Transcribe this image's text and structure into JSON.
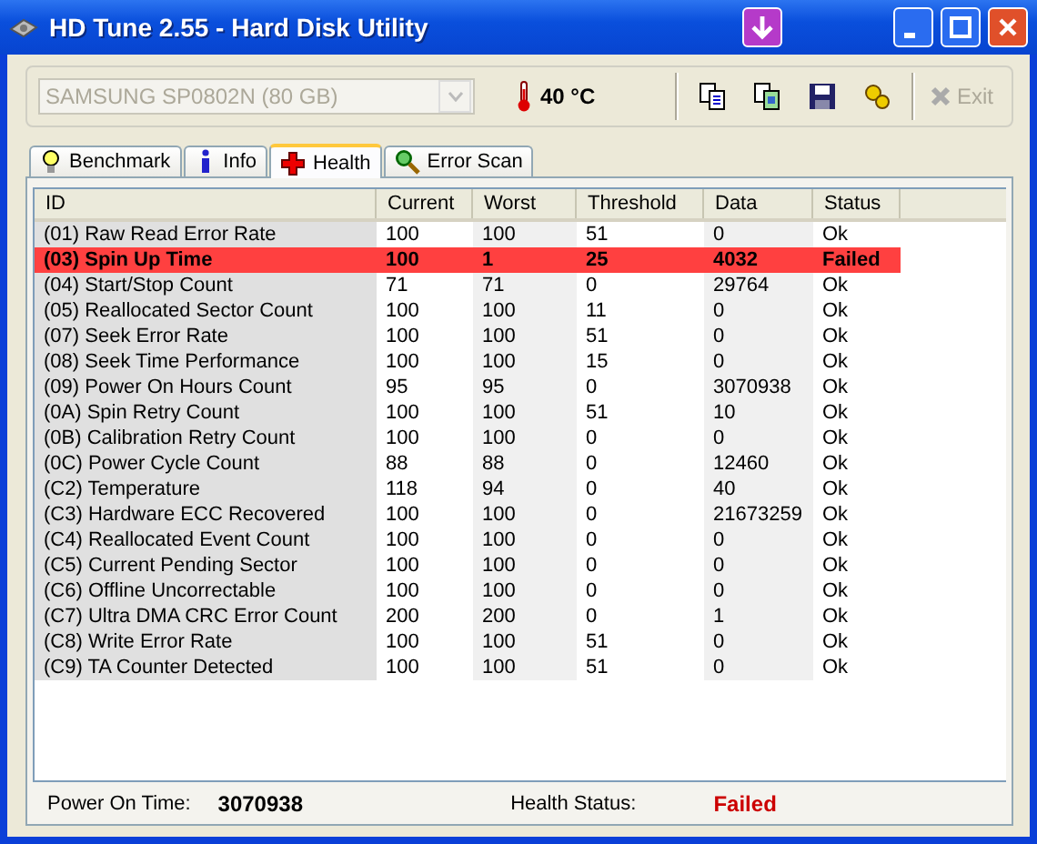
{
  "window": {
    "title": "HD Tune 2.55 - Hard Disk Utility"
  },
  "toolbar": {
    "drive": {
      "value": "SAMSUNG SP0802N (80 GB)",
      "disabled": true
    },
    "temperature": "40 °C",
    "exit": {
      "label": "Exit",
      "disabled": true
    }
  },
  "tabs": [
    {
      "label": "Benchmark",
      "selected": false,
      "kind": "bulb"
    },
    {
      "label": "Info",
      "selected": false,
      "kind": "info"
    },
    {
      "label": "Health",
      "selected": true,
      "kind": "cross"
    },
    {
      "label": "Error Scan",
      "selected": false,
      "kind": "magnifier"
    }
  ],
  "table": {
    "columns": [
      "ID",
      "Current",
      "Worst",
      "Threshold",
      "Data",
      "Status"
    ],
    "rows": [
      {
        "cells": [
          "(01) Raw Read Error Rate",
          "100",
          "100",
          "51",
          "0",
          "Ok"
        ],
        "failed": false
      },
      {
        "cells": [
          "(03) Spin Up Time",
          "100",
          "1",
          "25",
          "4032",
          "Failed"
        ],
        "failed": true
      },
      {
        "cells": [
          "(04) Start/Stop Count",
          "71",
          "71",
          "0",
          "29764",
          "Ok"
        ],
        "failed": false
      },
      {
        "cells": [
          "(05) Reallocated Sector Count",
          "100",
          "100",
          "11",
          "0",
          "Ok"
        ],
        "failed": false
      },
      {
        "cells": [
          "(07) Seek Error Rate",
          "100",
          "100",
          "51",
          "0",
          "Ok"
        ],
        "failed": false
      },
      {
        "cells": [
          "(08) Seek Time Performance",
          "100",
          "100",
          "15",
          "0",
          "Ok"
        ],
        "failed": false
      },
      {
        "cells": [
          "(09) Power On Hours Count",
          "95",
          "95",
          "0",
          "3070938",
          "Ok"
        ],
        "failed": false
      },
      {
        "cells": [
          "(0A) Spin Retry Count",
          "100",
          "100",
          "51",
          "10",
          "Ok"
        ],
        "failed": false
      },
      {
        "cells": [
          "(0B) Calibration Retry Count",
          "100",
          "100",
          "0",
          "0",
          "Ok"
        ],
        "failed": false
      },
      {
        "cells": [
          "(0C) Power Cycle Count",
          "88",
          "88",
          "0",
          "12460",
          "Ok"
        ],
        "failed": false
      },
      {
        "cells": [
          "(C2) Temperature",
          "118",
          "94",
          "0",
          "40",
          "Ok"
        ],
        "failed": false
      },
      {
        "cells": [
          "(C3) Hardware ECC Recovered",
          "100",
          "100",
          "0",
          "21673259",
          "Ok"
        ],
        "failed": false
      },
      {
        "cells": [
          "(C4) Reallocated Event Count",
          "100",
          "100",
          "0",
          "0",
          "Ok"
        ],
        "failed": false
      },
      {
        "cells": [
          "(C5) Current Pending Sector",
          "100",
          "100",
          "0",
          "0",
          "Ok"
        ],
        "failed": false
      },
      {
        "cells": [
          "(C6) Offline Uncorrectable",
          "100",
          "100",
          "0",
          "0",
          "Ok"
        ],
        "failed": false
      },
      {
        "cells": [
          "(C7) Ultra DMA CRC Error Count",
          "200",
          "200",
          "0",
          "1",
          "Ok"
        ],
        "failed": false
      },
      {
        "cells": [
          "(C8) Write Error Rate",
          "100",
          "100",
          "51",
          "0",
          "Ok"
        ],
        "failed": false
      },
      {
        "cells": [
          "(C9) TA Counter Detected",
          "100",
          "100",
          "51",
          "0",
          "Ok"
        ],
        "failed": false
      }
    ]
  },
  "footer": {
    "power_on_label": "Power On Time:",
    "power_on_value": "3070938",
    "health_label": "Health Status:",
    "health_value": "Failed",
    "health_failed": true
  }
}
